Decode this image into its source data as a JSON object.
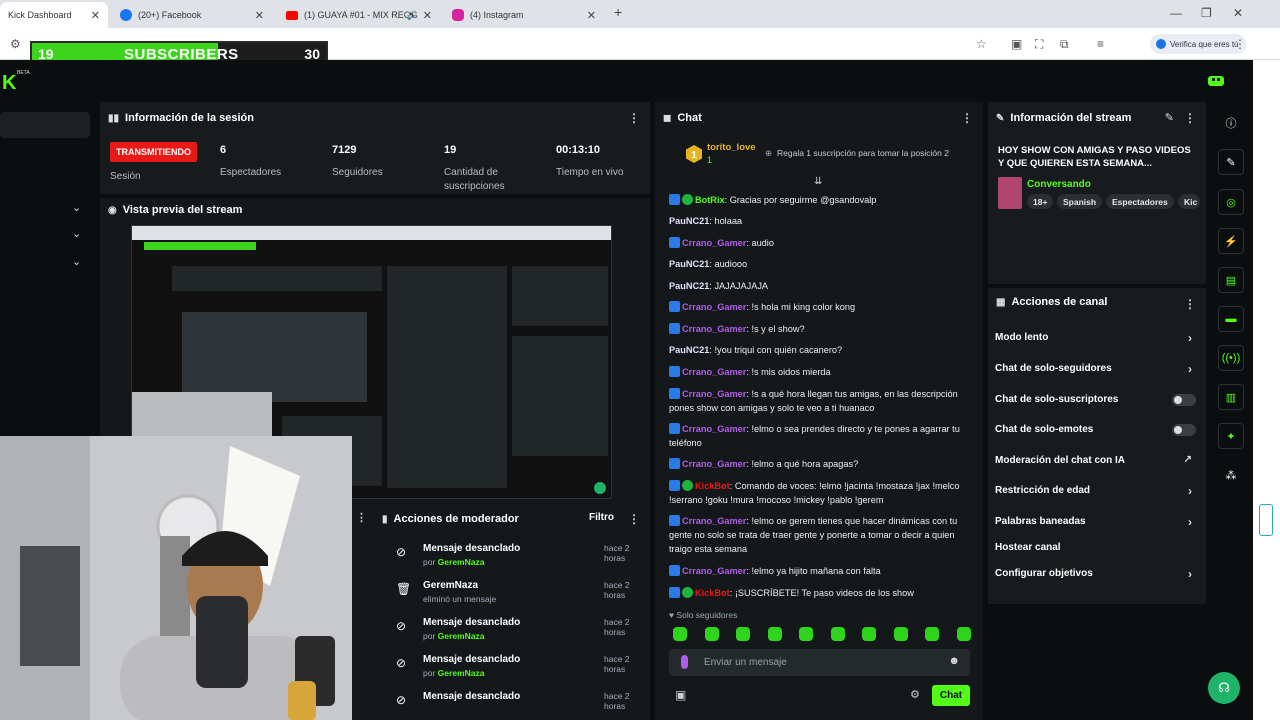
{
  "browser": {
    "tabs": [
      {
        "label": "Kick Dashboard",
        "icon": "kick-icon",
        "active": true
      },
      {
        "label": "(20+) Facebook",
        "icon": "facebook-icon",
        "active": false
      },
      {
        "label": "(1) GUAYA #01 - MIX REGG",
        "icon": "youtube-icon",
        "active": false
      },
      {
        "label": "(4) Instagram",
        "icon": "instagram-icon",
        "active": false
      }
    ],
    "new_tab": "+",
    "verify_label": "Verifica que eres tú",
    "colors": {
      "tabbar": "#dfe3e8",
      "facebook": "#1877f2",
      "youtube": "#ff0000",
      "instagram": "#d6249f"
    }
  },
  "overlay": {
    "current": "19",
    "label": "SUBSCRIBERS",
    "goal": "30",
    "progress": 0.633,
    "color": "#3ed31d"
  },
  "app": {
    "logo": "K",
    "beta": "BETA",
    "accent": "#53fc18"
  },
  "session": {
    "title": "Información de la sesión",
    "status": "TRANSMITIENDO",
    "status_label": "Sesión",
    "stats": [
      {
        "value": "6",
        "label": "Espectadores"
      },
      {
        "value": "7129",
        "label": "Seguidores"
      },
      {
        "value": "19",
        "label": "Cantidad de suscripciones"
      },
      {
        "value": "00:13:10",
        "label": "Tiempo en vivo"
      }
    ]
  },
  "preview": {
    "title": "Vista previa del stream"
  },
  "mod": {
    "title": "Acciones de moderador",
    "filter": "Filtro",
    "by": "por",
    "items": [
      {
        "action": "Mensaje desanclado",
        "user": "GeremNaza",
        "time": "hace 2 horas",
        "icon": "unpin-icon"
      },
      {
        "action": "GeremNaza",
        "detail": "eliminó un mensaje",
        "time": "hace 2 horas",
        "icon": "trash-icon"
      },
      {
        "action": "Mensaje desanclado",
        "user": "GeremNaza",
        "time": "hace 2 horas",
        "icon": "unpin-icon"
      },
      {
        "action": "Mensaje desanclado",
        "user": "GeremNaza",
        "time": "hace 2 horas",
        "icon": "unpin-icon"
      },
      {
        "action": "Mensaje desanclado",
        "user": "",
        "time": "hace 2 horas",
        "icon": "unpin-icon"
      }
    ]
  },
  "chat": {
    "title": "Chat",
    "pinned_user": "torito_love",
    "pinned_count": "1",
    "gift_text": "Regala 1 suscripción para tomar la posición 2",
    "messages": [
      {
        "user": "BotRix",
        "color": "#53fc18",
        "badges": 2,
        "text": "Gracias por seguirme @gsandovalp"
      },
      {
        "user": "PauNC21",
        "color": "#dfe3ff",
        "badges": 0,
        "text": "holaaa"
      },
      {
        "user": "Crrano_Gamer",
        "color": "#b05de8",
        "badges": 1,
        "text": "audio"
      },
      {
        "user": "PauNC21",
        "color": "#dfe3ff",
        "badges": 0,
        "text": "audiooo"
      },
      {
        "user": "PauNC21",
        "color": "#dfe3ff",
        "badges": 0,
        "text": "JAJAJAJAJA"
      },
      {
        "user": "Crrano_Gamer",
        "color": "#b05de8",
        "badges": 1,
        "text": "!s hola mi king color kong"
      },
      {
        "user": "Crrano_Gamer",
        "color": "#b05de8",
        "badges": 1,
        "text": "!s y el show?"
      },
      {
        "user": "PauNC21",
        "color": "#dfe3ff",
        "badges": 0,
        "text": "!you triqui con quién cacanero?"
      },
      {
        "user": "Crrano_Gamer",
        "color": "#b05de8",
        "badges": 1,
        "text": "!s mis oidos mierda"
      },
      {
        "user": "Crrano_Gamer",
        "color": "#b05de8",
        "badges": 1,
        "text": "!s a qué hora llegan tus amigas, en las descripción pones show con amigas y solo te veo a ti huanaco"
      },
      {
        "user": "Crrano_Gamer",
        "color": "#b05de8",
        "badges": 1,
        "text": "!elmo o sea prendes directo y te pones a agarrar tu teléfono"
      },
      {
        "user": "Crrano_Gamer",
        "color": "#b05de8",
        "badges": 1,
        "text": "!elmo a qué hora apagas?"
      },
      {
        "user": "KickBot",
        "color": "#e91916",
        "badges": 2,
        "text": "Comando de voces: !elmo !jacinta !mostaza !jax !melco !serrano !goku !mura !mocoso !mickey !pablo !gerem"
      },
      {
        "user": "Crrano_Gamer",
        "color": "#b05de8",
        "badges": 1,
        "text": "!elmo oe gerem tienes que hacer dinámicas con tu gente no solo se trata de traer gente y ponerte a tomar o decir a quien traigo esta semana"
      },
      {
        "user": "Crrano_Gamer",
        "color": "#b05de8",
        "badges": 1,
        "text": "!elmo ya hijito mañana con falta"
      },
      {
        "user": "KickBot",
        "color": "#e91916",
        "badges": 2,
        "text": "¡SUSCRÍBETE! Te paso videos de los show"
      }
    ],
    "followers_mode": "Solo seguidores",
    "input_placeholder": "Enviar un mensaje",
    "send_label": "Chat"
  },
  "stream": {
    "title": "Información del stream",
    "stream_title": "HOY SHOW CON AMIGAS Y PASO VIDEOS Y QUE QUIEREN ESTA SEMANA...",
    "category": "Conversando",
    "tags": [
      "18+",
      "Spanish",
      "Espectadores",
      "Kic"
    ]
  },
  "actions": {
    "title": "Acciones de canal",
    "items": [
      {
        "label": "Modo lento",
        "control": "arrow"
      },
      {
        "label": "Chat de solo-seguidores",
        "control": "arrow"
      },
      {
        "label": "Chat de solo-suscriptores",
        "control": "toggle"
      },
      {
        "label": "Chat de solo-emotes",
        "control": "toggle"
      },
      {
        "label": "Moderación del chat con IA",
        "control": "external"
      },
      {
        "label": "Restricción de edad",
        "control": "arrow"
      },
      {
        "label": "Palabras baneadas",
        "control": "arrow"
      },
      {
        "label": "Hostear canal",
        "control": "none"
      },
      {
        "label": "Configurar objetivos",
        "control": "arrow"
      }
    ]
  }
}
